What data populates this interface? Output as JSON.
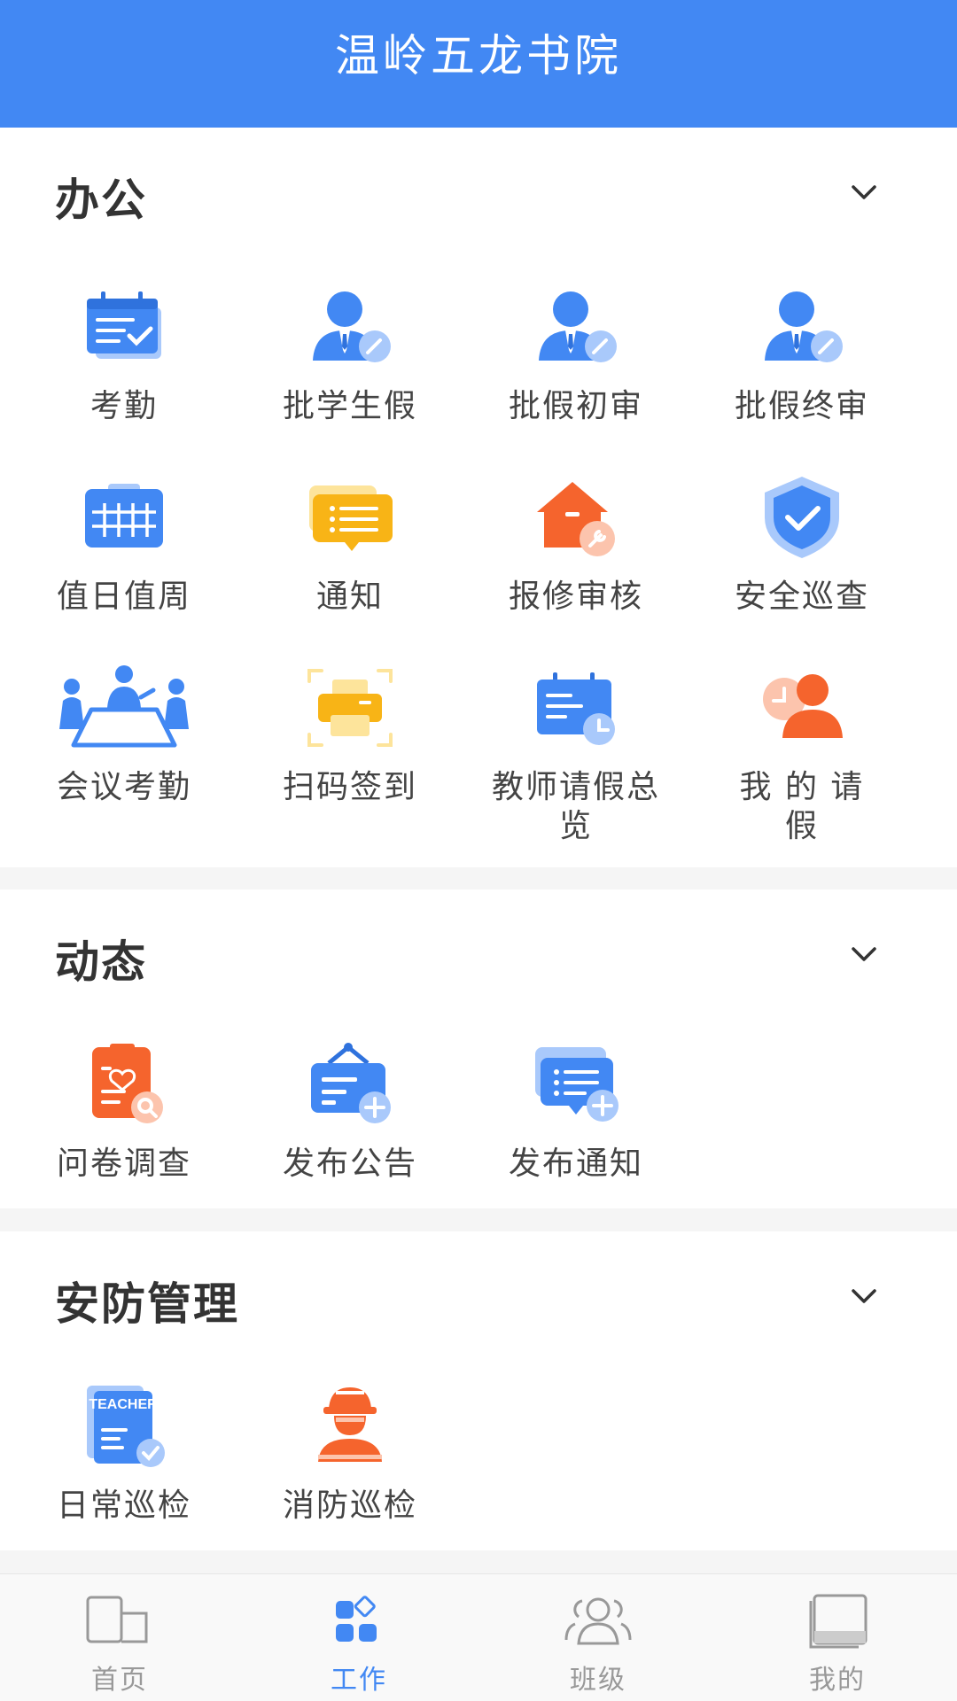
{
  "header": {
    "title": "温岭五龙书院"
  },
  "sections": [
    {
      "title": "办公",
      "items": [
        {
          "label": "考勤",
          "icon": "calendar-check-icon"
        },
        {
          "label": "批学生假",
          "icon": "person-approve-icon"
        },
        {
          "label": "批假初审",
          "icon": "person-approve-icon"
        },
        {
          "label": "批假终审",
          "icon": "person-approve-icon"
        },
        {
          "label": "值日值周",
          "icon": "calendar-grid-icon"
        },
        {
          "label": "通知",
          "icon": "notice-icon"
        },
        {
          "label": "报修审核",
          "icon": "house-repair-icon"
        },
        {
          "label": "安全巡查",
          "icon": "shield-check-icon"
        },
        {
          "label": "会议考勤",
          "icon": "meeting-icon"
        },
        {
          "label": "扫码签到",
          "icon": "scan-printer-icon"
        },
        {
          "label": "教师请假总览",
          "icon": "board-clock-icon"
        },
        {
          "label": "我 的 请 假",
          "icon": "person-clock-icon"
        }
      ]
    },
    {
      "title": "动态",
      "items": [
        {
          "label": "问卷调查",
          "icon": "survey-icon"
        },
        {
          "label": "发布公告",
          "icon": "announce-add-icon"
        },
        {
          "label": "发布通知",
          "icon": "message-add-icon"
        }
      ]
    },
    {
      "title": "安防管理",
      "items": [
        {
          "label": "日常巡检",
          "icon": "teacher-book-icon",
          "badge": "TEACHER"
        },
        {
          "label": "消防巡检",
          "icon": "firefighter-icon"
        }
      ]
    }
  ],
  "tabs": [
    {
      "label": "首页",
      "icon": "home-icon",
      "active": false
    },
    {
      "label": "工作",
      "icon": "apps-icon",
      "active": true
    },
    {
      "label": "班级",
      "icon": "group-icon",
      "active": false
    },
    {
      "label": "我的",
      "icon": "book-icon",
      "active": false
    }
  ],
  "colors": {
    "primary": "#4288f3",
    "orange": "#f5642d",
    "yellow": "#f8b416",
    "inactive": "#999999"
  }
}
